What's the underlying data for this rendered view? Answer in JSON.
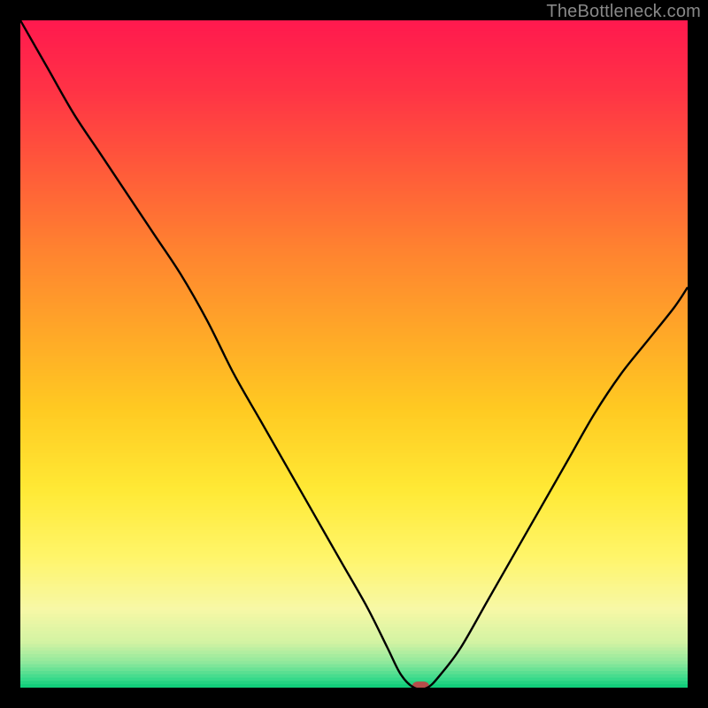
{
  "watermark": "TheBottleneck.com",
  "chart_data": {
    "type": "line",
    "title": "",
    "xlabel": "",
    "ylabel": "",
    "xlim": [
      0,
      100
    ],
    "ylim": [
      0,
      100
    ],
    "curve": {
      "x": [
        0,
        4,
        8,
        12,
        16,
        20,
        24,
        28,
        32,
        36,
        40,
        44,
        48,
        52,
        55,
        57,
        59,
        61,
        63,
        66,
        70,
        74,
        78,
        82,
        86,
        90,
        94,
        98,
        100
      ],
      "y": [
        100,
        93,
        86,
        80,
        74,
        68,
        62,
        55,
        47,
        40,
        33,
        26,
        19,
        12,
        6,
        2,
        0,
        0,
        2,
        6,
        13,
        20,
        27,
        34,
        41,
        47,
        52,
        57,
        60
      ]
    },
    "minimum_marker": {
      "x": 60,
      "y": 0,
      "width": 2.5,
      "height": 1.3
    },
    "gradient_stops": [
      {
        "pos": 0.0,
        "color": "#ff1a4e"
      },
      {
        "pos": 0.1,
        "color": "#ff3246"
      },
      {
        "pos": 0.22,
        "color": "#ff5a3a"
      },
      {
        "pos": 0.34,
        "color": "#ff8230"
      },
      {
        "pos": 0.46,
        "color": "#ffa628"
      },
      {
        "pos": 0.58,
        "color": "#ffca22"
      },
      {
        "pos": 0.7,
        "color": "#ffe935"
      },
      {
        "pos": 0.8,
        "color": "#fff569"
      },
      {
        "pos": 0.88,
        "color": "#f7f8a6"
      },
      {
        "pos": 0.93,
        "color": "#d2f3a3"
      },
      {
        "pos": 0.96,
        "color": "#8fe89c"
      },
      {
        "pos": 0.985,
        "color": "#36d98a"
      },
      {
        "pos": 1.0,
        "color": "#00c873"
      }
    ],
    "marker_color": "#b54d4a"
  }
}
